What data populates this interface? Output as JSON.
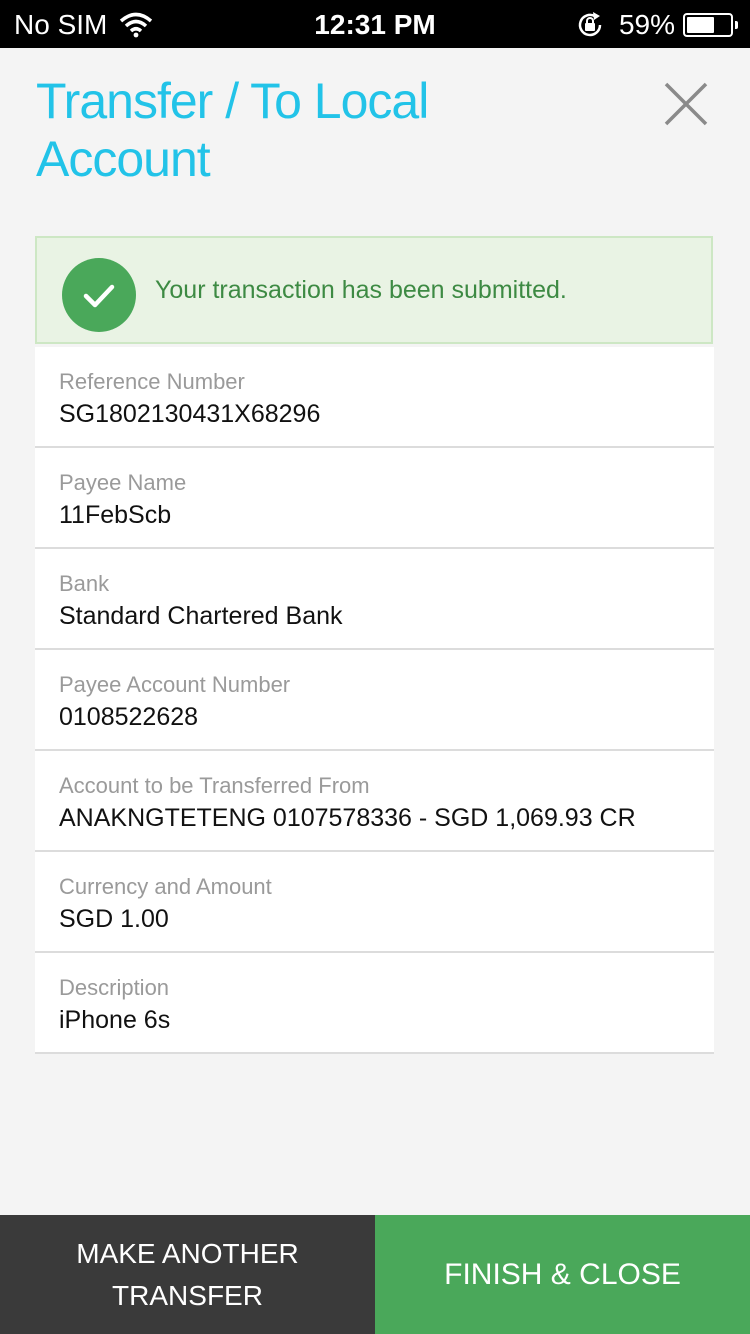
{
  "status_bar": {
    "carrier": "No SIM",
    "time": "12:31 PM",
    "battery": "59%",
    "battery_level": 0.59,
    "icons": [
      "wifi-icon",
      "rotation-lock-icon",
      "battery-icon"
    ]
  },
  "header": {
    "title": "Transfer / To Local Account",
    "close_icon": "close-icon"
  },
  "banner": {
    "message": "Your transaction has been submitted.",
    "icon": "checkmark-icon",
    "color": "#4aa85a"
  },
  "details": [
    {
      "label": "Reference Number",
      "value": "SG1802130431X68296"
    },
    {
      "label": "Payee Name",
      "value": "11FebScb"
    },
    {
      "label": "Bank",
      "value": "Standard Chartered Bank"
    },
    {
      "label": "Payee Account Number",
      "value": "0108522628"
    },
    {
      "label": "Account to be Transferred From",
      "value": "ANAKNGTETENG 0107578336 - SGD 1,069.93 CR"
    },
    {
      "label": "Currency and Amount",
      "value": "SGD 1.00"
    },
    {
      "label": "Description",
      "value": "iPhone 6s"
    }
  ],
  "actions": {
    "make_another": "MAKE ANOTHER TRANSFER",
    "finish": "FINISH & CLOSE"
  },
  "colors": {
    "title": "#22c3e8",
    "primary": "#4aa85a",
    "secondary": "#3a3a3a"
  }
}
